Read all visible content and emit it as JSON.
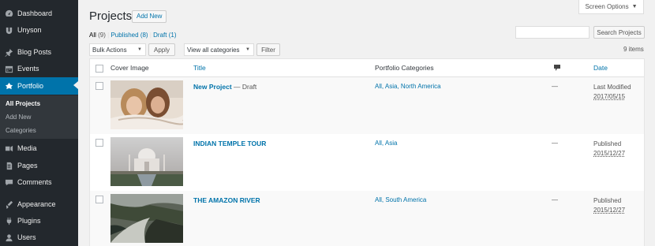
{
  "sidebar": {
    "items": [
      {
        "label": "Dashboard",
        "icon": "dashboard-icon"
      },
      {
        "label": "Unyson",
        "icon": "unyson-icon"
      },
      {
        "label": "Blog Posts",
        "icon": "pin-icon"
      },
      {
        "label": "Events",
        "icon": "calendar-icon"
      },
      {
        "label": "Portfolio",
        "icon": "portfolio-icon",
        "current": true
      },
      {
        "label": "Media",
        "icon": "media-icon"
      },
      {
        "label": "Pages",
        "icon": "pages-icon"
      },
      {
        "label": "Comments",
        "icon": "comments-icon"
      },
      {
        "label": "Appearance",
        "icon": "appearance-icon"
      },
      {
        "label": "Plugins",
        "icon": "plugins-icon"
      },
      {
        "label": "Users",
        "icon": "users-icon"
      }
    ],
    "submenu": [
      {
        "label": "All Projects",
        "current": true
      },
      {
        "label": "Add New"
      },
      {
        "label": "Categories"
      }
    ]
  },
  "header": {
    "title": "Projects",
    "add_new": "Add New",
    "screen_options": "Screen Options",
    "screen_options_caret": "▼"
  },
  "views": {
    "all_label": "All",
    "all_count": "(9)",
    "published_label": "Published",
    "published_count": "(8)",
    "draft_label": "Draft",
    "draft_count": "(1)",
    "separator": " | "
  },
  "search": {
    "placeholder": "",
    "button": "Search Projects"
  },
  "toolbar": {
    "bulk_actions": "Bulk Actions",
    "apply": "Apply",
    "categories_filter": "View all categories",
    "filter": "Filter",
    "items_count": "9 items"
  },
  "table": {
    "columns": {
      "cover": "Cover Image",
      "title": "Title",
      "categories": "Portfolio Categories",
      "comments_icon": "comment-bubble-icon",
      "date": "Date"
    },
    "rows": [
      {
        "title": "New Project",
        "state": " — Draft",
        "categories": "All, Asia, North America",
        "comments": "—",
        "date_status": "Last Modified",
        "date": "2017/05/15"
      },
      {
        "title": "INDIAN TEMPLE TOUR",
        "state": "",
        "categories": "All, Asia",
        "comments": "—",
        "date_status": "Published",
        "date": "2015/12/27"
      },
      {
        "title": "THE AMAZON RIVER",
        "state": "",
        "categories": "All, South America",
        "comments": "—",
        "date_status": "Published",
        "date": "2015/12/27"
      }
    ]
  },
  "colors": {
    "sidebar_bg": "#23282d",
    "accent": "#0073aa",
    "page_bg": "#f1f1f1"
  }
}
